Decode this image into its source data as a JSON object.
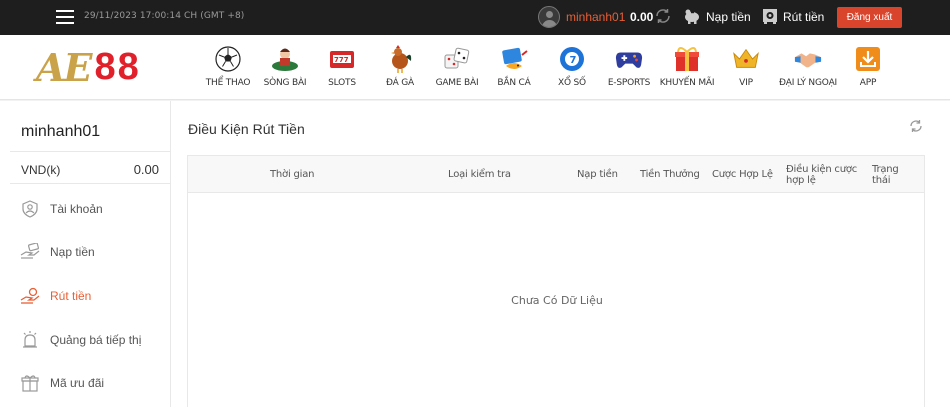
{
  "topbar": {
    "datetime": "29/11/2023 17:00:14 CH (GMT +8)",
    "username": "minhanh01",
    "balance": "0.00",
    "deposit_label": "Nạp tiền",
    "withdraw_label": "Rút tiền",
    "logout_label": "Đăng xuất"
  },
  "logo": {
    "letters": "AE",
    "number": "88"
  },
  "nav": {
    "items": [
      {
        "label": "THỂ THAO",
        "icon": "soccer-ball-icon"
      },
      {
        "label": "SÒNG BÀI",
        "icon": "casino-dealer-icon"
      },
      {
        "label": "SLOTS",
        "icon": "slot-machine-icon"
      },
      {
        "label": "ĐÁ GÀ",
        "icon": "rooster-icon"
      },
      {
        "label": "GAME BÀI",
        "icon": "dice-icon"
      },
      {
        "label": "BẮN CÁ",
        "icon": "fish-shooting-icon"
      },
      {
        "label": "XỔ SỐ",
        "icon": "lottery-ball-icon"
      },
      {
        "label": "E-SPORTS",
        "icon": "gamepad-icon"
      },
      {
        "label": "KHUYẾN MÃI",
        "icon": "gift-icon"
      },
      {
        "label": "VIP",
        "icon": "crown-icon"
      },
      {
        "label": "ĐẠI LÝ NGOẠI",
        "icon": "handshake-icon"
      },
      {
        "label": "APP",
        "icon": "download-icon"
      }
    ]
  },
  "sidebar": {
    "username": "minhanh01",
    "currency": "VND(k)",
    "amount": "0.00",
    "items": [
      {
        "label": "Tài khoản",
        "icon": "user-shield-icon"
      },
      {
        "label": "Nạp tiền",
        "icon": "deposit-hand-icon"
      },
      {
        "label": "Rút tiền",
        "icon": "withdraw-hand-icon",
        "active": true
      },
      {
        "label": "Quảng bá tiếp thị",
        "icon": "marketing-icon"
      },
      {
        "label": "Mã ưu đãi",
        "icon": "coupon-gift-icon"
      }
    ]
  },
  "main": {
    "title": "Điều Kiện Rút Tiền",
    "columns": [
      "Thời gian",
      "Loại kiểm tra",
      "Nạp tiền",
      "Tiền Thưởng",
      "Cược Hợp Lệ",
      "Điều kiện cược hợp lệ",
      "Trạng thái"
    ],
    "empty_text": "Chưa Có Dữ Liệu"
  },
  "colors": {
    "accent": "#e85f36",
    "logout": "#d9442c",
    "topbar": "#1e1e1e",
    "logo_gold": "#c9a24a",
    "logo_red": "#e0202a"
  }
}
